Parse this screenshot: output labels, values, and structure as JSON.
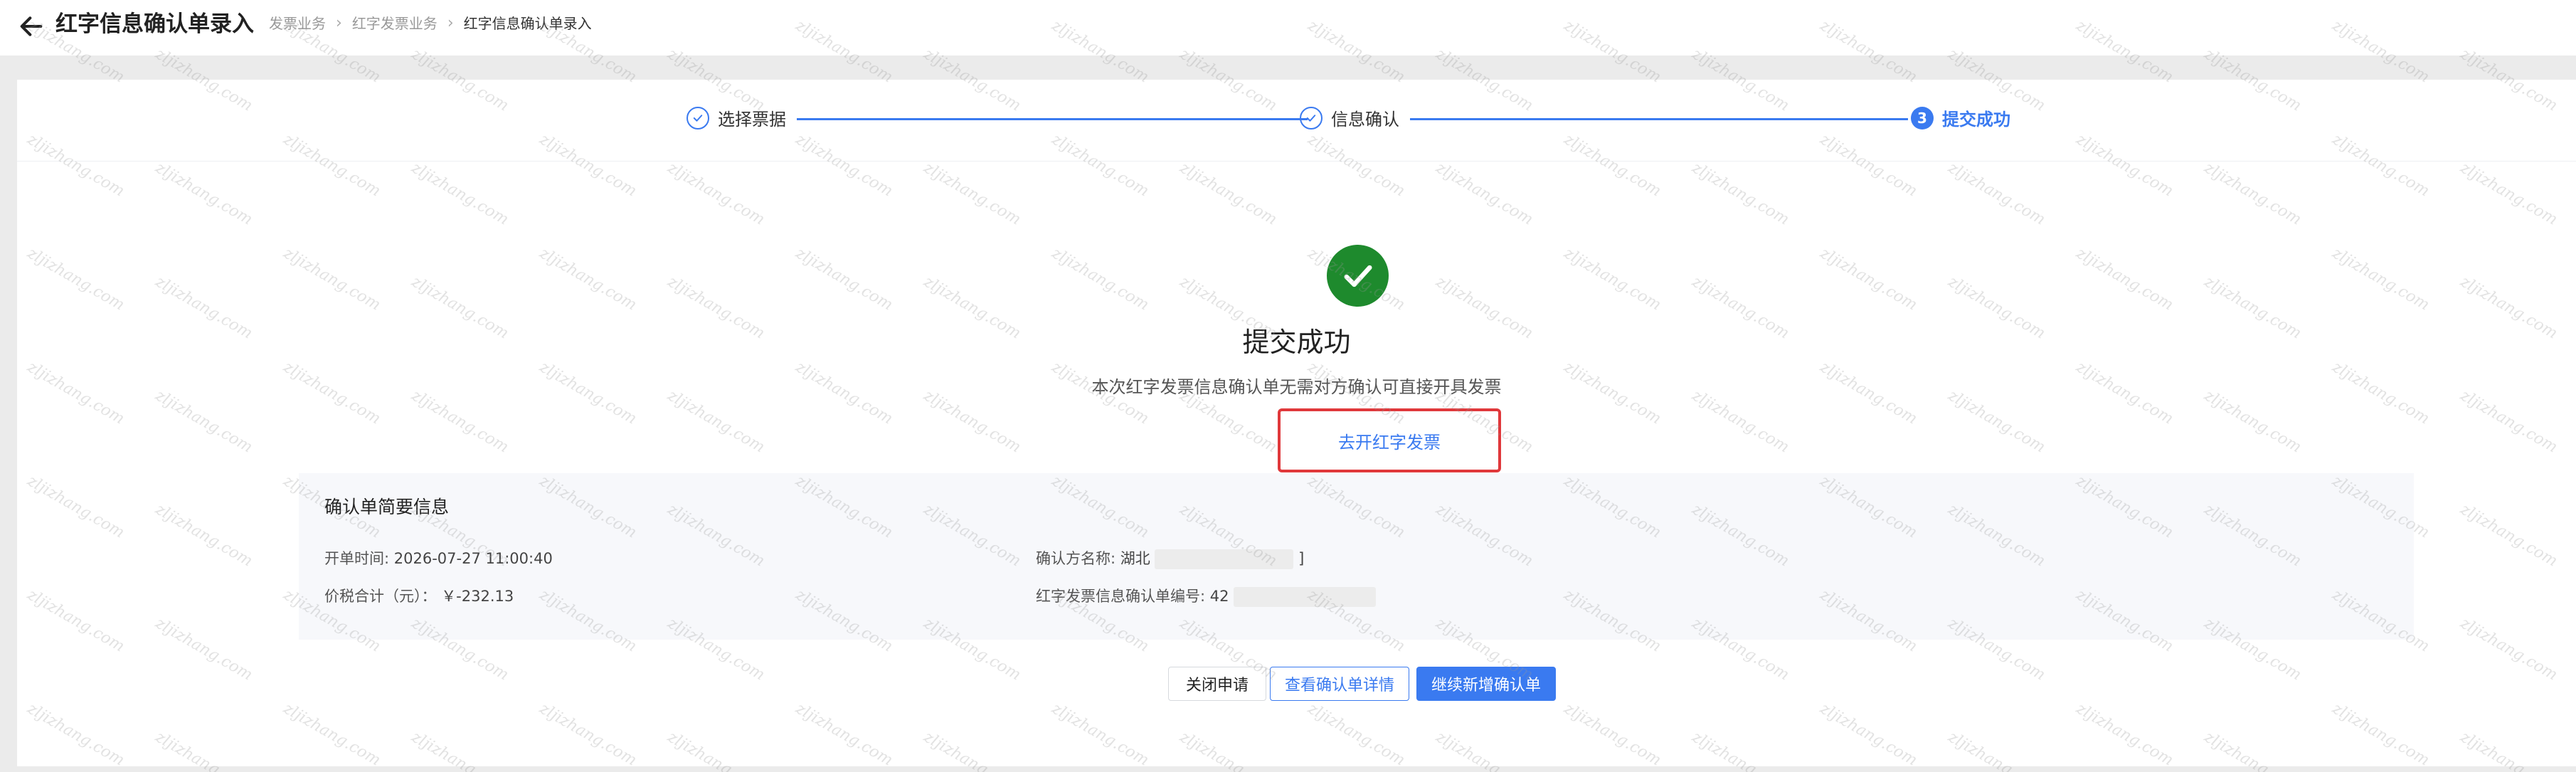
{
  "header": {
    "title": "红字信息确认单录入",
    "breadcrumb": [
      "发票业务",
      "红字发票业务",
      "红字信息确认单录入"
    ]
  },
  "steps": [
    {
      "label": "选择票据",
      "status": "done"
    },
    {
      "label": "信息确认",
      "status": "done"
    },
    {
      "label": "提交成功",
      "status": "active",
      "number": "3"
    }
  ],
  "result": {
    "title": "提交成功",
    "description": "本次红字发票信息确认单无需对方确认可直接开具发票",
    "link_label": "去开红字发票"
  },
  "summary": {
    "title": "确认单简要信息",
    "issue_time_label": "开单时间:",
    "issue_time_value": "2026-07-27 11:00:40",
    "total_label": "价税合计（元）：",
    "total_value": "￥-232.13",
    "confirm_party_label": "确认方名称:",
    "confirm_party_value": "湖北",
    "confirm_party_suffix": "]",
    "confirm_number_label": "红字发票信息确认单编号:",
    "confirm_number_value": "42"
  },
  "buttons": {
    "close": "关闭申请",
    "view_detail": "查看确认单详情",
    "continue": "继续新增确认单"
  },
  "watermark": "zljizhang.com",
  "colors": {
    "accent": "#3a7af0",
    "success": "#1e8a2d",
    "highlight": "#e0383b"
  }
}
